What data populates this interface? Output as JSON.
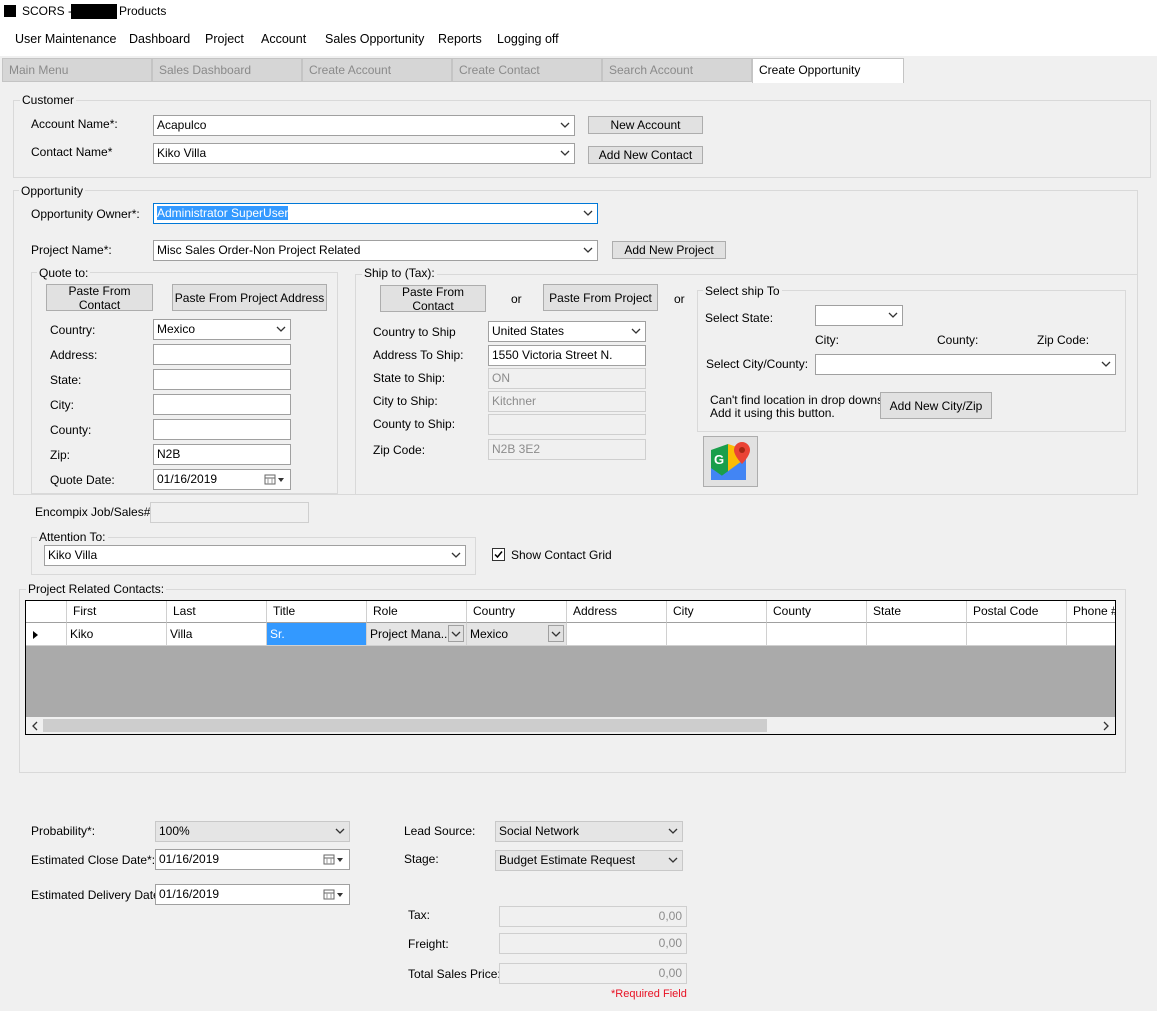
{
  "window": {
    "title_prefix": "SCORS -",
    "title_suffix": "Products"
  },
  "menu": [
    "User Maintenance",
    "Dashboard",
    "Project",
    "Account",
    "Sales Opportunity",
    "Reports",
    "Logging off"
  ],
  "tabs": [
    "Main Menu",
    "Sales Dashboard",
    "Create Account",
    "Create Contact",
    "Search Account",
    "Create Opportunity"
  ],
  "active_tab": "Create Opportunity",
  "customer": {
    "group_label": "Customer",
    "account_label": "Account Name*:",
    "account_value": "Acapulco",
    "contact_label": "Contact Name*",
    "contact_value": "Kiko Villa",
    "new_account_btn": "New Account",
    "add_contact_btn": "Add New Contact"
  },
  "opportunity": {
    "group_label": "Opportunity",
    "owner_label": "Opportunity Owner*:",
    "owner_value": "Administrator SuperUser",
    "project_label": "Project Name*:",
    "project_value": "Misc Sales Order-Non Project Related",
    "add_project_btn": "Add New Project"
  },
  "quote_to": {
    "group_label": "Quote to:",
    "paste_contact_btn": "Paste From Contact",
    "paste_project_btn": "Paste From Project Address",
    "country_label": "Country:",
    "country_value": "Mexico",
    "address_label": "Address:",
    "state_label": "State:",
    "city_label": "City:",
    "county_label": "County:",
    "zip_label": "Zip:",
    "zip_value": "N2B",
    "date_label": "Quote Date:",
    "date_value": "01/16/2019"
  },
  "ship_to": {
    "group_label": "Ship to (Tax):",
    "paste_contact_btn": "Paste From Contact",
    "or1": "or",
    "paste_project_btn": "Paste From Project",
    "or2": "or",
    "country_label": "Country to Ship",
    "country_value": "United States",
    "address_label": "Address To Ship:",
    "address_value": "1550 Victoria Street N.",
    "state_label": "State to Ship:",
    "state_value": "ON",
    "city_label": "City to Ship:",
    "city_value": "Kitchner",
    "county_label": "County to Ship:",
    "county_value": "",
    "zip_label": "Zip Code:",
    "zip_value": "N2B 3E2"
  },
  "select_ship": {
    "group_label": "Select ship To",
    "state_label": "Select State:",
    "city_header": "City:",
    "county_header": "County:",
    "zip_header": "Zip Code:",
    "city_county_label": "Select City/County:",
    "help_line1": "Can't find location in drop downs?",
    "help_line2": "Add it using this button.",
    "add_city_btn": "Add New City/Zip"
  },
  "job_label": "Encompix Job/Sales#:",
  "attention": {
    "group_label": "Attention To:",
    "value": "Kiko Villa",
    "show_grid_label": "Show Contact Grid"
  },
  "contacts": {
    "group_label": "Project Related Contacts:",
    "columns": [
      "First",
      "Last",
      "Title",
      "Role",
      "Country",
      "Address",
      "City",
      "County",
      "State",
      "Postal Code",
      "Phone #"
    ],
    "row": [
      "Kiko",
      "Villa",
      "Sr.",
      "Project Mana...",
      "Mexico",
      "",
      "",
      "",
      "",
      "",
      ""
    ]
  },
  "bottom": {
    "probability_label": "Probability*:",
    "probability_value": "100%",
    "close_label": "Estimated Close Date*:",
    "close_value": "01/16/2019",
    "delivery_label": "Estimated Delivery Date*:",
    "delivery_value": "01/16/2019",
    "lead_label": "Lead Source:",
    "lead_value": "Social Network",
    "stage_label": "Stage:",
    "stage_value": "Budget Estimate Request",
    "tax_label": "Tax:",
    "tax_value": "0,00",
    "freight_label": "Freight:",
    "freight_value": "0,00",
    "total_label": "Total Sales Price:",
    "total_value": "0,00",
    "required_note": "*Required Field"
  },
  "colors": {
    "selection": "#3399ff",
    "required": "#e81123"
  }
}
